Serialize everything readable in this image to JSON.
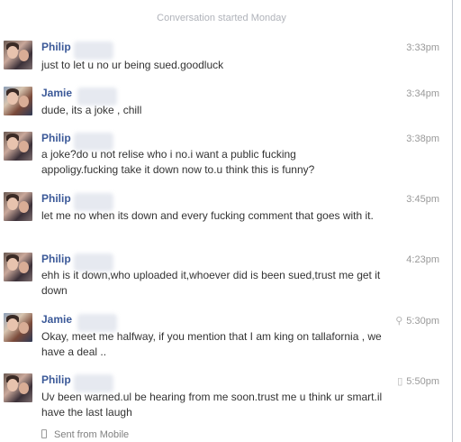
{
  "conversation_started": "Conversation started Monday",
  "messages": [
    {
      "sender": "Philip",
      "time": "3:33pm",
      "icon": "",
      "text": "just to let u no ur being sued.goodluck"
    },
    {
      "sender": "Jamie",
      "time": "3:34pm",
      "icon": "",
      "text": "dude, its a joke , chill"
    },
    {
      "sender": "Philip",
      "time": "3:38pm",
      "icon": "",
      "text": "a joke?do u not relise who i no.i want a public fucking appoligy.fucking take it down now to.u think this is funny?"
    },
    {
      "sender": "Philip",
      "time": "3:45pm",
      "icon": "",
      "text": "let me no when its down and every fucking comment that goes with it."
    },
    {
      "sender": "Philip",
      "time": "4:23pm",
      "icon": "",
      "text": "ehh is it down,who uploaded it,whoever did is been sued,trust me get it down"
    },
    {
      "sender": "Jamie",
      "time": "5:30pm",
      "icon": "location-pin-icon",
      "text": "Okay, meet me halfway, if you mention that I am king on tallafornia , we have a deal .."
    },
    {
      "sender": "Philip",
      "time": "5:50pm",
      "icon": "mobile-phone-icon",
      "text": "Uv been warned.ul be hearing from me soon.trust me u think ur smart.il have the last laugh"
    }
  ],
  "footer": {
    "sent_from": "Sent from Mobile"
  }
}
